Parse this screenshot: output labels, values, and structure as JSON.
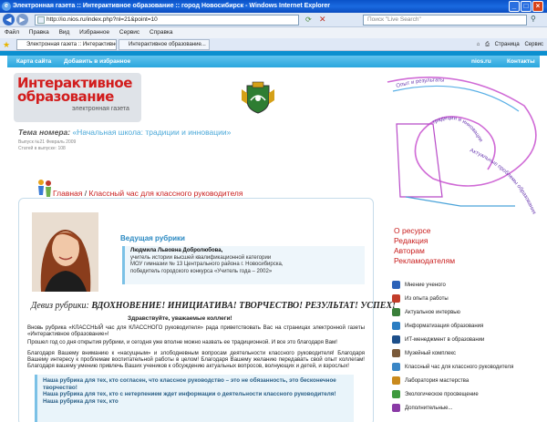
{
  "window": {
    "title": "Электронная газета :: Интерактивное образование :: город Новосибирск - Windows Internet Explorer",
    "min_glyph": "_",
    "max_glyph": "□",
    "close_glyph": "×"
  },
  "addressbar": {
    "url": "http://io.nios.ru/index.php?nl=21&point=10",
    "search_placeholder": "Поиск \"Live Search\""
  },
  "menu": [
    "Файл",
    "Правка",
    "Вид",
    "Избранное",
    "Сервис",
    "Справка"
  ],
  "favbar": {
    "tab1": "Электронная газета :: Интерактивное образовани...",
    "tab2": "Интерактивное образование...",
    "tools": [
      "Страница",
      "Сервис"
    ]
  },
  "site": {
    "nav": {
      "sitemap": "Карта сайта",
      "favorites": "Добавить в избранное",
      "nios": "nios.ru",
      "contacts": "Контакты"
    },
    "logo": {
      "line1": "Интерактивное",
      "line2": "образование",
      "sub": "электронная газета"
    },
    "theme": {
      "label": "Тема номера:",
      "value": "«Начальная школа: традиции и инновации»"
    },
    "issue": "Выпуск №21 Февраль 2009",
    "articles": "Статей в выпуске: 108",
    "breadcrumb": {
      "home": "Главная",
      "sep": " / ",
      "section": "Классный час для классного руководителя"
    },
    "lead_title": "Ведущая рубрики",
    "author": {
      "name": "Людмила Львовна Добролюбова,",
      "l1": "учитель истории высшей квалификационной категории",
      "l2": "МОУ гимназии № 13 Центрального района г. Новосибирска,",
      "l3": "победитель городского конкурса «Учитель года – 2002»"
    },
    "motto": {
      "label": "Девиз рубрики:",
      "text": "ВДОХНОВЕНИЕ! ИНИЦИАТИВА! ТВОРЧЕСТВО! РЕЗУЛЬТАТ! УСПЕХ!"
    },
    "greeting": "Здравствуйте, уважаемые коллеги!",
    "p1": "Вновь рубрика «КЛАССНЫЙ час для КЛАССНОГО руководителя» рада приветствовать Вас на страницах электронной газеты «Интерактивное образование»!",
    "p2": "Прошел год со дня открытия рубрики, и сегодня уже вполне можно назвать ее традиционной. И все это благодаря Вам!",
    "p3": "Благодаря Вашему вниманию к «насущным» и злободневным вопросам деятельности классного руководителя! Благодаря Вашему интересу к проблемам воспитательной работы в целом! Благодаря Вашему желанию передавать свой опыт коллегам! Благодаря вашему умению привлечь Ваших учеников к обсуждению актуальных вопросов, волнующих и детей, и взрослых!",
    "q1": "Наша рубрика для тех, кто согласен, что классное руководство – это не обязанность, это бесконечное творчество!",
    "q2": "Наша рубрика для тех, кто с нетерпением ждет информации о деятельности классного руководителя!",
    "q3": "Наша рубрика для тех, кто"
  },
  "spiral_text": [
    "Опыт и результаты",
    "традиции и инновации",
    "Актуальные проблемы образования"
  ],
  "right_links": [
    "О ресурсе",
    "Редакция",
    "Авторам",
    "Рекламодателям"
  ],
  "right_list": [
    {
      "label": "Мнение ученого",
      "icon": "person-icon",
      "color": "#2b62b8"
    },
    {
      "label": "Из опыта работы",
      "icon": "handshake-icon",
      "color": "#c23d2a"
    },
    {
      "label": "Актуальное интервью",
      "icon": "microphone-icon",
      "color": "#3a7f3a"
    },
    {
      "label": "Информатизация образования",
      "icon": "monitor-icon",
      "color": "#2a7dc2"
    },
    {
      "label": "ИТ-менеджмент в образовании",
      "icon": "it-icon",
      "color": "#1d4f8a"
    },
    {
      "label": "Музейный комплекс",
      "icon": "museum-icon",
      "color": "#7a5a3a"
    },
    {
      "label": "Классный час для классного руководителя",
      "icon": "people-icon",
      "color": "#3a86c6"
    },
    {
      "label": "Лаборатория мастерства",
      "icon": "lab-icon",
      "color": "#c98a1d"
    },
    {
      "label": "Экологическое просвещение",
      "icon": "leaf-icon",
      "color": "#3e9a3e"
    },
    {
      "label": "Дополнительные...",
      "icon": "book-icon",
      "color": "#8a3aa6"
    }
  ]
}
